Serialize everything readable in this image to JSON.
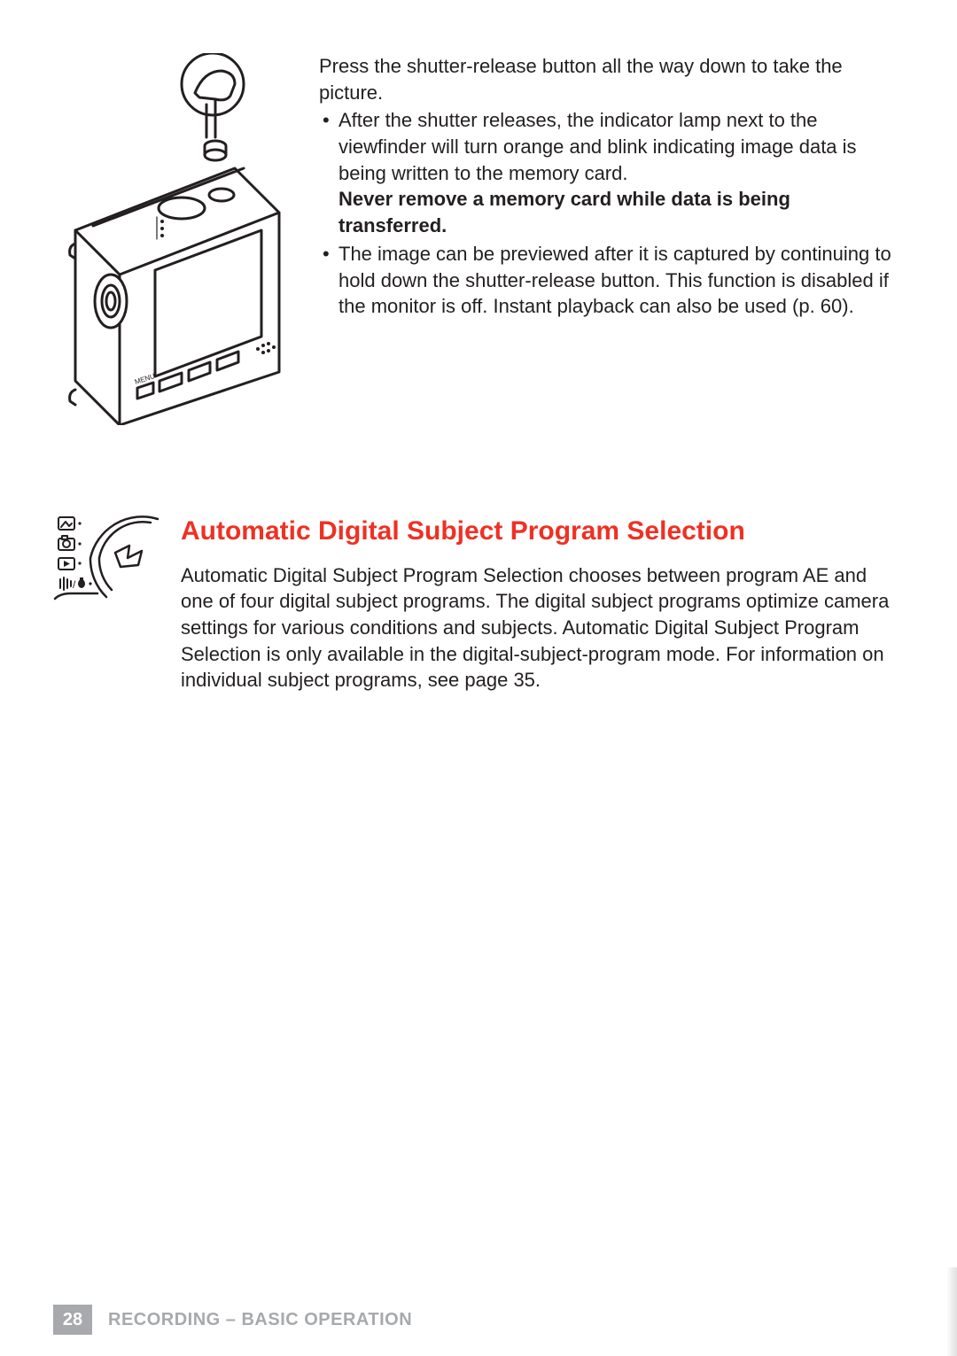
{
  "section1": {
    "intro": "Press the shutter-release button all the way down to take the picture.",
    "bullet1_a": "After the shutter releases, the indicator lamp next to the viewfinder will turn orange and blink indicating image data is being written to the memory card.",
    "bullet1_b": "Never remove a memory card while data is being transferred.",
    "bullet2": "The image can be previewed after it is captured by continuing to hold down the shutter-release button. This function is disabled if the monitor is off. Instant playback can also be used (p. 60)."
  },
  "section2": {
    "heading": "Automatic Digital Subject Program Selection",
    "body": "Automatic Digital Subject Program Selection chooses between program AE and one of four digital subject programs. The digital subject programs optimize camera settings for various conditions and subjects. Automatic Digital Subject Program Selection is only available in the digital-subject-program mode. For information on individual subject programs, see page 35."
  },
  "footer": {
    "page_number": "28",
    "section_title": "RECORDING – BASIC OPERATION"
  },
  "icons": {
    "camera": "camera-illustration",
    "dial": "mode-dial-illustration"
  }
}
